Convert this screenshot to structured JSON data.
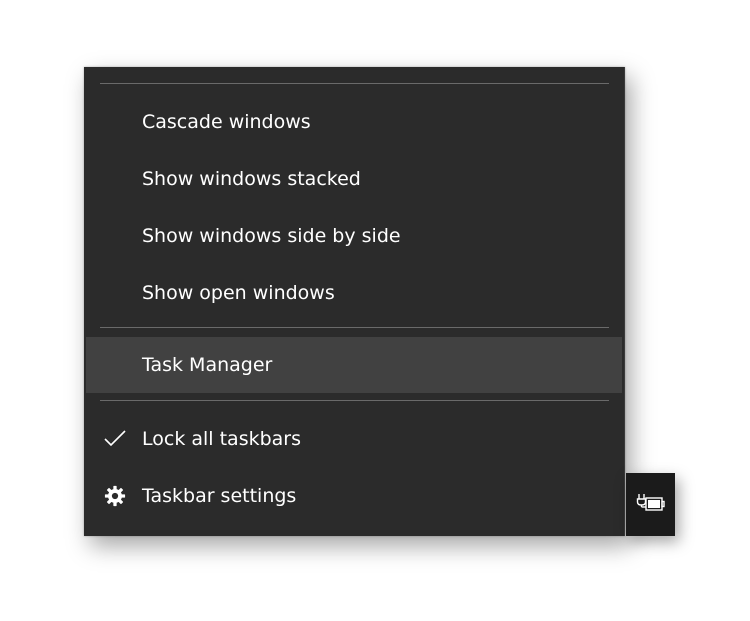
{
  "context_menu": {
    "items": [
      {
        "label": "Cascade windows"
      },
      {
        "label": "Show windows stacked"
      },
      {
        "label": "Show windows side by side"
      },
      {
        "label": "Show open windows"
      },
      {
        "label": "Task Manager",
        "highlighted": true
      },
      {
        "label": "Lock all taskbars",
        "checked": true,
        "icon": "checkmark-icon"
      },
      {
        "label": "Taskbar settings",
        "icon": "gear-icon"
      }
    ]
  },
  "tray": {
    "icon": "battery-charging-icon"
  },
  "colors": {
    "menu_background": "#2b2b2b",
    "menu_highlight": "#414141",
    "separator": "#6a6a6a",
    "text": "#ffffff",
    "tray_background": "#1b1b1b"
  }
}
